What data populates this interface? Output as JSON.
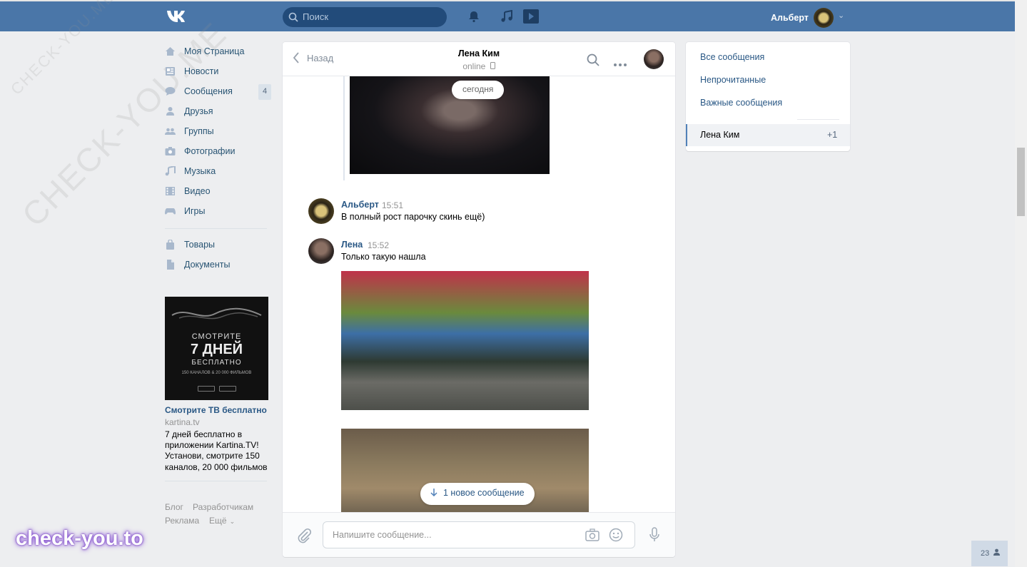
{
  "header": {
    "search_placeholder": "Поиск",
    "user_name": "Альберт"
  },
  "sidebar": {
    "items": [
      {
        "label": "Моя Страница",
        "icon": "home-icon"
      },
      {
        "label": "Новости",
        "icon": "news-icon"
      },
      {
        "label": "Сообщения",
        "icon": "messages-icon",
        "badge": "4"
      },
      {
        "label": "Друзья",
        "icon": "friends-icon"
      },
      {
        "label": "Группы",
        "icon": "groups-icon"
      },
      {
        "label": "Фотографии",
        "icon": "camera-icon"
      },
      {
        "label": "Музыка",
        "icon": "music-icon"
      },
      {
        "label": "Видео",
        "icon": "video-icon"
      },
      {
        "label": "Игры",
        "icon": "games-icon"
      }
    ],
    "items2": [
      {
        "label": "Товары",
        "icon": "bag-icon"
      },
      {
        "label": "Документы",
        "icon": "document-icon"
      }
    ],
    "ad": {
      "line1": "СМОТРИТЕ",
      "line2": "7 ДНЕЙ",
      "line3": "БЕСПЛАТНО",
      "line4": "150 КАНАЛОВ & 20 000 ФИЛЬМОВ",
      "title": "Смотрите ТВ бесплатно",
      "domain": "kartina.tv",
      "description": "7 дней бесплатно в приложении Kartina.TV! Установи, смотрите 150 каналов, 20 000 фильмов"
    },
    "footer": {
      "blog": "Блог",
      "developers": "Разработчикам",
      "ads": "Реклама",
      "more": "Ещё"
    }
  },
  "chat": {
    "back_label": "Назад",
    "peer_name": "Лена Ким",
    "peer_status": "online",
    "date_pill": "сегодня",
    "messages": [
      {
        "author": "Альберт",
        "time": "15:51",
        "text": "В полный рост парочку скинь ещё)"
      },
      {
        "author": "Лена",
        "time": "15:52",
        "text": "Только такую нашла"
      }
    ],
    "new_messages_label": "1 новое сообщение",
    "composer_placeholder": "Напишите сообщение..."
  },
  "right_panel": {
    "filters": [
      "Все сообщения",
      "Непрочитанные",
      "Важные сообщения"
    ],
    "active_dialog": {
      "name": "Лена Ким",
      "count": "+1"
    }
  },
  "watermark": {
    "text": "CHECK-YOU.ME",
    "brand": "check-you.to"
  },
  "online_counter": "23",
  "colors": {
    "header_bg": "#4a76a8",
    "link": "#2a5885",
    "page_bg": "#edeef0"
  }
}
